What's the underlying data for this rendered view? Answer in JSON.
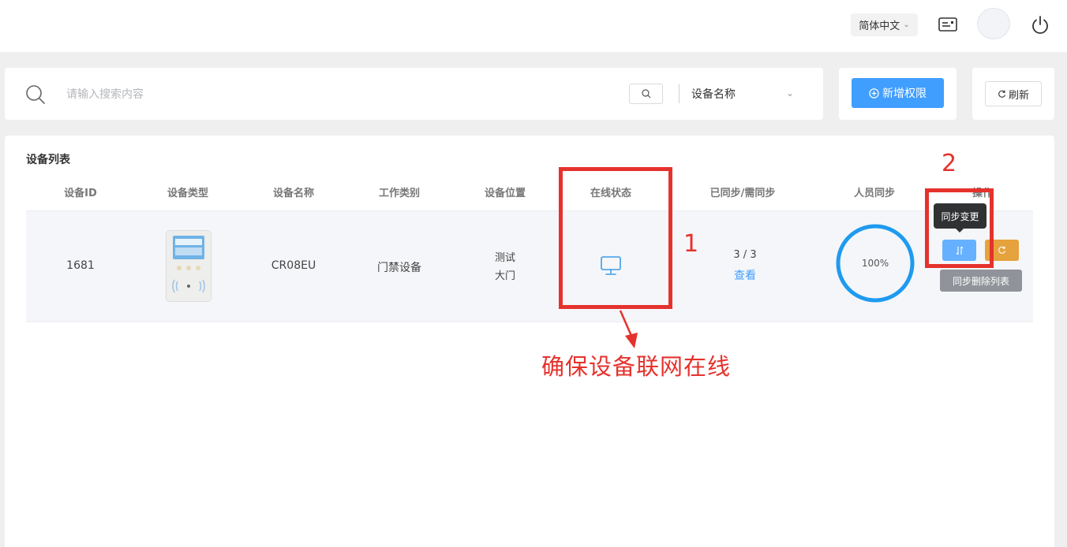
{
  "header": {
    "language_label": "简体中文"
  },
  "search": {
    "placeholder": "请输入搜索内容",
    "field_label": "设备名称"
  },
  "toolbar": {
    "add_label": "新增权限",
    "refresh_label": "刷新"
  },
  "device_list": {
    "title": "设备列表",
    "columns": [
      "设备ID",
      "设备类型",
      "设备名称",
      "工作类别",
      "设备位置",
      "在线状态",
      "已同步/需同步",
      "人员同步",
      "操作"
    ],
    "rows": [
      {
        "device_id": "1681",
        "device_name": "CR08EU",
        "work_type": "门禁设备",
        "location_line1": "测试",
        "location_line2": "大门",
        "online_status_icon": "monitor-icon",
        "sync_count": "3 / 3",
        "view_label": "查看",
        "person_sync": "100%",
        "person_sync_fraction": 1.0
      }
    ]
  },
  "tooltips": {
    "sync_change": "同步变更",
    "sync_delete_list": "同步删除列表"
  },
  "annotations": {
    "label_1": "1",
    "label_2": "2",
    "note": "确保设备联网在线"
  },
  "colors": {
    "primary": "#409eff",
    "warning": "#e6a23c",
    "annotation_red": "#e5322d",
    "progress_blue": "#1e9bf0"
  }
}
